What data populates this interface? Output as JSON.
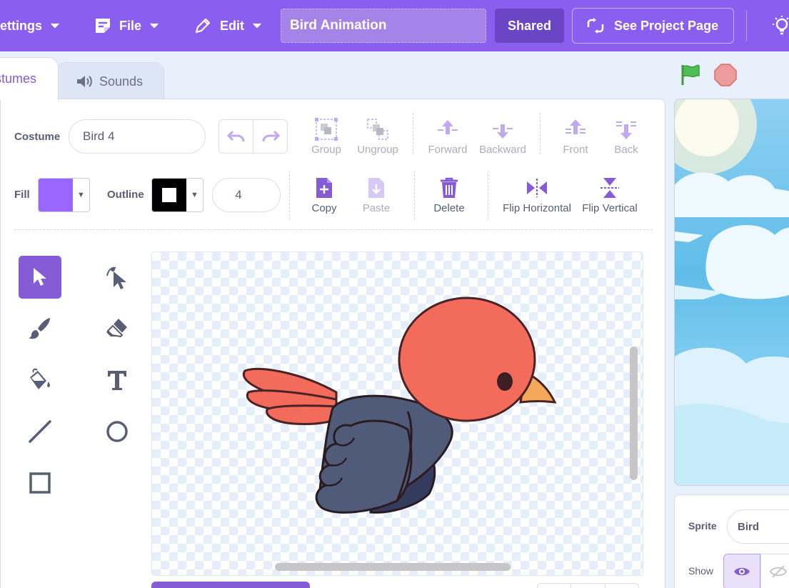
{
  "menubar": {
    "settings_label": "ettings",
    "file_label": "File",
    "edit_label": "Edit",
    "project_title": "Bird Animation",
    "shared_label": "Shared",
    "see_project_label": "See Project Page"
  },
  "tabs": {
    "costumes_label": "stumes",
    "sounds_label": "Sounds"
  },
  "editor": {
    "costume_label": "Costume",
    "costume_name": "Bird 4",
    "fill_label": "Fill",
    "outline_label": "Outline",
    "outline_width": "4",
    "fill_color": "#9966ff",
    "outline_color": "#000000",
    "actions": {
      "group": "Group",
      "ungroup": "Ungroup",
      "forward": "Forward",
      "backward": "Backward",
      "front": "Front",
      "back": "Back",
      "copy": "Copy",
      "paste": "Paste",
      "delete": "Delete",
      "flip_horizontal": "Flip Horizontal",
      "flip_vertical": "Flip Vertical"
    },
    "tools": [
      "select-icon",
      "reshape-icon",
      "brush-icon",
      "eraser-icon",
      "fill-icon",
      "text-icon",
      "line-icon",
      "circle-icon",
      "rectangle-icon"
    ],
    "active_tool": "select-icon"
  },
  "sprite": {
    "sprite_label": "Sprite",
    "sprite_name": "Bird",
    "show_label": "Show"
  },
  "colors": {
    "menubar": "#8a5ff0",
    "accent": "#855cd6",
    "bird_head": "#f26b5b",
    "bird_body": "#4f5b78",
    "beak": "#f4a95a"
  }
}
